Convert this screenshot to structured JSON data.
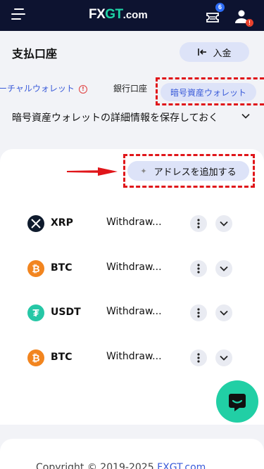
{
  "header": {
    "logo_fx": "FX",
    "logo_gt": "GT",
    "logo_domain": ".com",
    "notifications_count": "6",
    "profile_alert": "!"
  },
  "page": {
    "title": "支払口座",
    "deposit_label": "入金"
  },
  "tabs": {
    "virtual_label": "ーチャルウォレット",
    "bank_label": "銀行口座",
    "crypto_label": "暗号資産ウォレット"
  },
  "save_details_label": "暗号資産ウォレットの詳細情報を保存しておく",
  "add_address_label": "アドレスを追加する",
  "wallets": [
    {
      "symbol": "XRP",
      "name": "Withdraw..."
    },
    {
      "symbol": "BTC",
      "name": "Withdraw..."
    },
    {
      "symbol": "USDT",
      "name": "Withdraw..."
    },
    {
      "symbol": "BTC",
      "name": "Withdraw..."
    }
  ],
  "footer": {
    "copyright_text": "Copyright © 2019-2025 ",
    "copyright_link": "FXGT.com"
  },
  "colors": {
    "header_bg": "#0d1330",
    "accent_blue": "#3a5bd9",
    "pill_bg": "#dde3f8",
    "brand_green": "#21cfa5",
    "highlight_red": "#e0161a"
  },
  "icons": [
    "hamburger-icon",
    "ticket-icon",
    "user-icon",
    "enter-icon",
    "warning-icon",
    "chevron-down-icon",
    "plus-icon",
    "xrp-icon",
    "btc-icon",
    "usdt-icon",
    "more-vertical-icon",
    "chat-icon",
    "arrow-right-icon"
  ]
}
